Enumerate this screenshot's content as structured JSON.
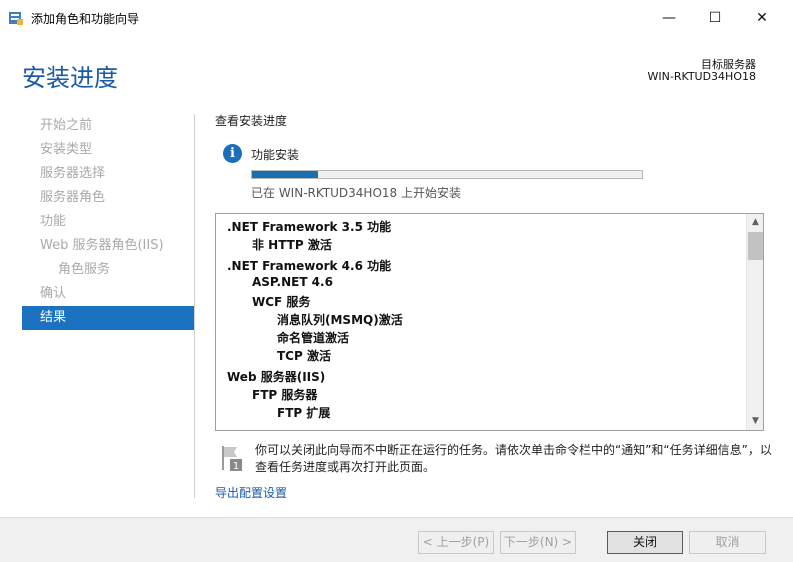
{
  "window": {
    "title": "添加角色和功能向导",
    "icon": "server-manager-icon",
    "minimize_glyph": "—",
    "maximize_glyph": "☐",
    "close_glyph": "✕"
  },
  "header": {
    "page_title": "安装进度",
    "target_label": "目标服务器",
    "target_name": "WIN-RKTUD34HO18"
  },
  "nav": {
    "items": [
      {
        "label": "开始之前",
        "state": "disabled"
      },
      {
        "label": "安装类型",
        "state": "disabled"
      },
      {
        "label": "服务器选择",
        "state": "disabled"
      },
      {
        "label": "服务器角色",
        "state": "disabled"
      },
      {
        "label": "功能",
        "state": "disabled"
      },
      {
        "label": "Web 服务器角色(IIS)",
        "state": "disabled"
      },
      {
        "label": "角色服务",
        "state": "disabled"
      },
      {
        "label": "确认",
        "state": "disabled"
      },
      {
        "label": "结果",
        "state": "active"
      }
    ]
  },
  "main": {
    "section_title": "查看安装进度",
    "info_icon_glyph": "i",
    "feature_label": "功能安装",
    "progress_fraction": 0.17,
    "progress_status": "已在 WIN-RKTUD34HO18 上开始安装",
    "results": [
      {
        "text": ".NET Framework 3.5 功能",
        "level": 0
      },
      {
        "text": "非 HTTP 激活",
        "level": 1
      },
      {
        "text": ".NET Framework 4.6 功能",
        "level": 0
      },
      {
        "text": "ASP.NET 4.6",
        "level": 1
      },
      {
        "text": "WCF 服务",
        "level": 1
      },
      {
        "text": "消息队列(MSMQ)激活",
        "level": 2
      },
      {
        "text": "命名管道激活",
        "level": 2
      },
      {
        "text": "TCP 激活",
        "level": 2
      },
      {
        "text": "Web 服务器(IIS)",
        "level": 0
      },
      {
        "text": "FTP 服务器",
        "level": 1
      },
      {
        "text": "FTP 扩展",
        "level": 2
      }
    ],
    "note_text": "你可以关闭此向导而不中断正在运行的任务。请依次单击命令栏中的“通知”和“任务详细信息”，以查看任务进度或再次打开此页面。",
    "note_badge": "1",
    "export_link": "导出配置设置"
  },
  "footer": {
    "prev_label": "< 上一步(P)",
    "next_label": "下一步(N) >",
    "close_label": "关闭",
    "cancel_label": "取消"
  },
  "colors": {
    "accent": "#1b5aa8",
    "nav_active": "#1b72c0",
    "progress": "#1a6faf"
  }
}
